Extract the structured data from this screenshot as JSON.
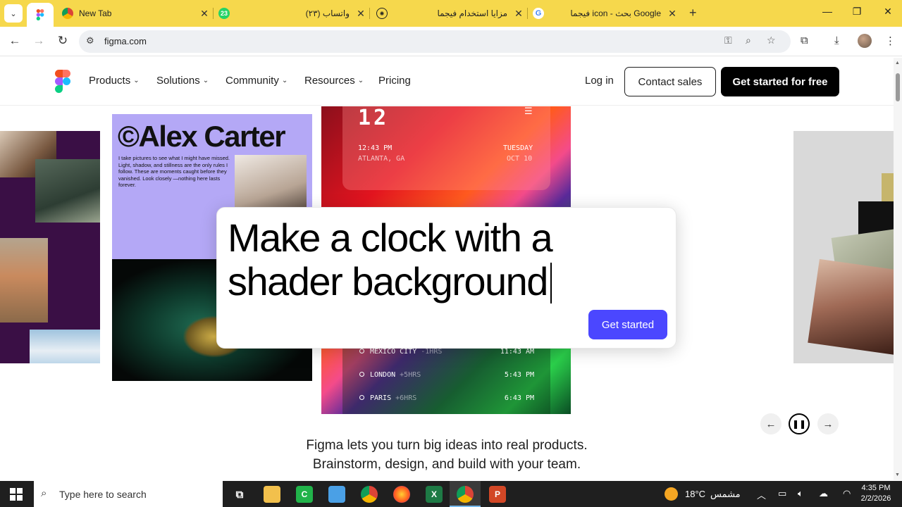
{
  "browser": {
    "tabs": [
      {
        "title": "",
        "favicon": "figma-icon",
        "active": true
      },
      {
        "title": "New Tab",
        "favicon": "chrome-icon"
      },
      {
        "title": "(٢٣) واتساب",
        "favicon": "whatsapp-icon",
        "badge": "23"
      },
      {
        "title": "مزايا استخدام فيجما",
        "favicon": "chatgpt-icon"
      },
      {
        "title": "فيجما icon - بحث Google",
        "favicon": "google-icon"
      }
    ],
    "url": "figma.com"
  },
  "nav": {
    "items": [
      {
        "label": "Products"
      },
      {
        "label": "Solutions"
      },
      {
        "label": "Community"
      },
      {
        "label": "Resources"
      },
      {
        "label": "Pricing"
      }
    ],
    "login": "Log in",
    "contact": "Contact sales",
    "get_started": "Get started for free"
  },
  "hero": {
    "alex": {
      "title": "©Alex Carter",
      "desc": "I take pictures to see what I might have missed. Light, shadow, and stillness are the only rules I follow. These are moments caught before they vanished. Look closely —nothing here lasts forever."
    },
    "clock": {
      "digits": "12",
      "time": "12:43 PM",
      "location": "ATLANTA, GA",
      "day": "TUESDAY",
      "date": "OCT 10",
      "zones": [
        {
          "city": "MEXICO CITY",
          "offset": "-1HRS",
          "time": "11:43 AM"
        },
        {
          "city": "LONDON",
          "offset": "+5HRS",
          "time": "5:43 PM"
        },
        {
          "city": "PARIS",
          "offset": "+6HRS",
          "time": "6:43 PM"
        }
      ]
    },
    "prompt": "Make a clock with a shader background",
    "prompt_button": "Get started",
    "tagline_line1": "Figma lets you turn big ideas into real products.",
    "tagline_line2": "Brainstorm, design, and build with your team."
  },
  "taskbar": {
    "search_placeholder": "Type here to search",
    "weather_temp": "18°C",
    "weather_desc": "مشمس",
    "time": "4:35 PM",
    "date": "2/2/2026"
  },
  "colors": {
    "tab_strip": "#f6d84c",
    "accent_button": "#4b47ff",
    "alex_purple": "#b4a8f6"
  }
}
